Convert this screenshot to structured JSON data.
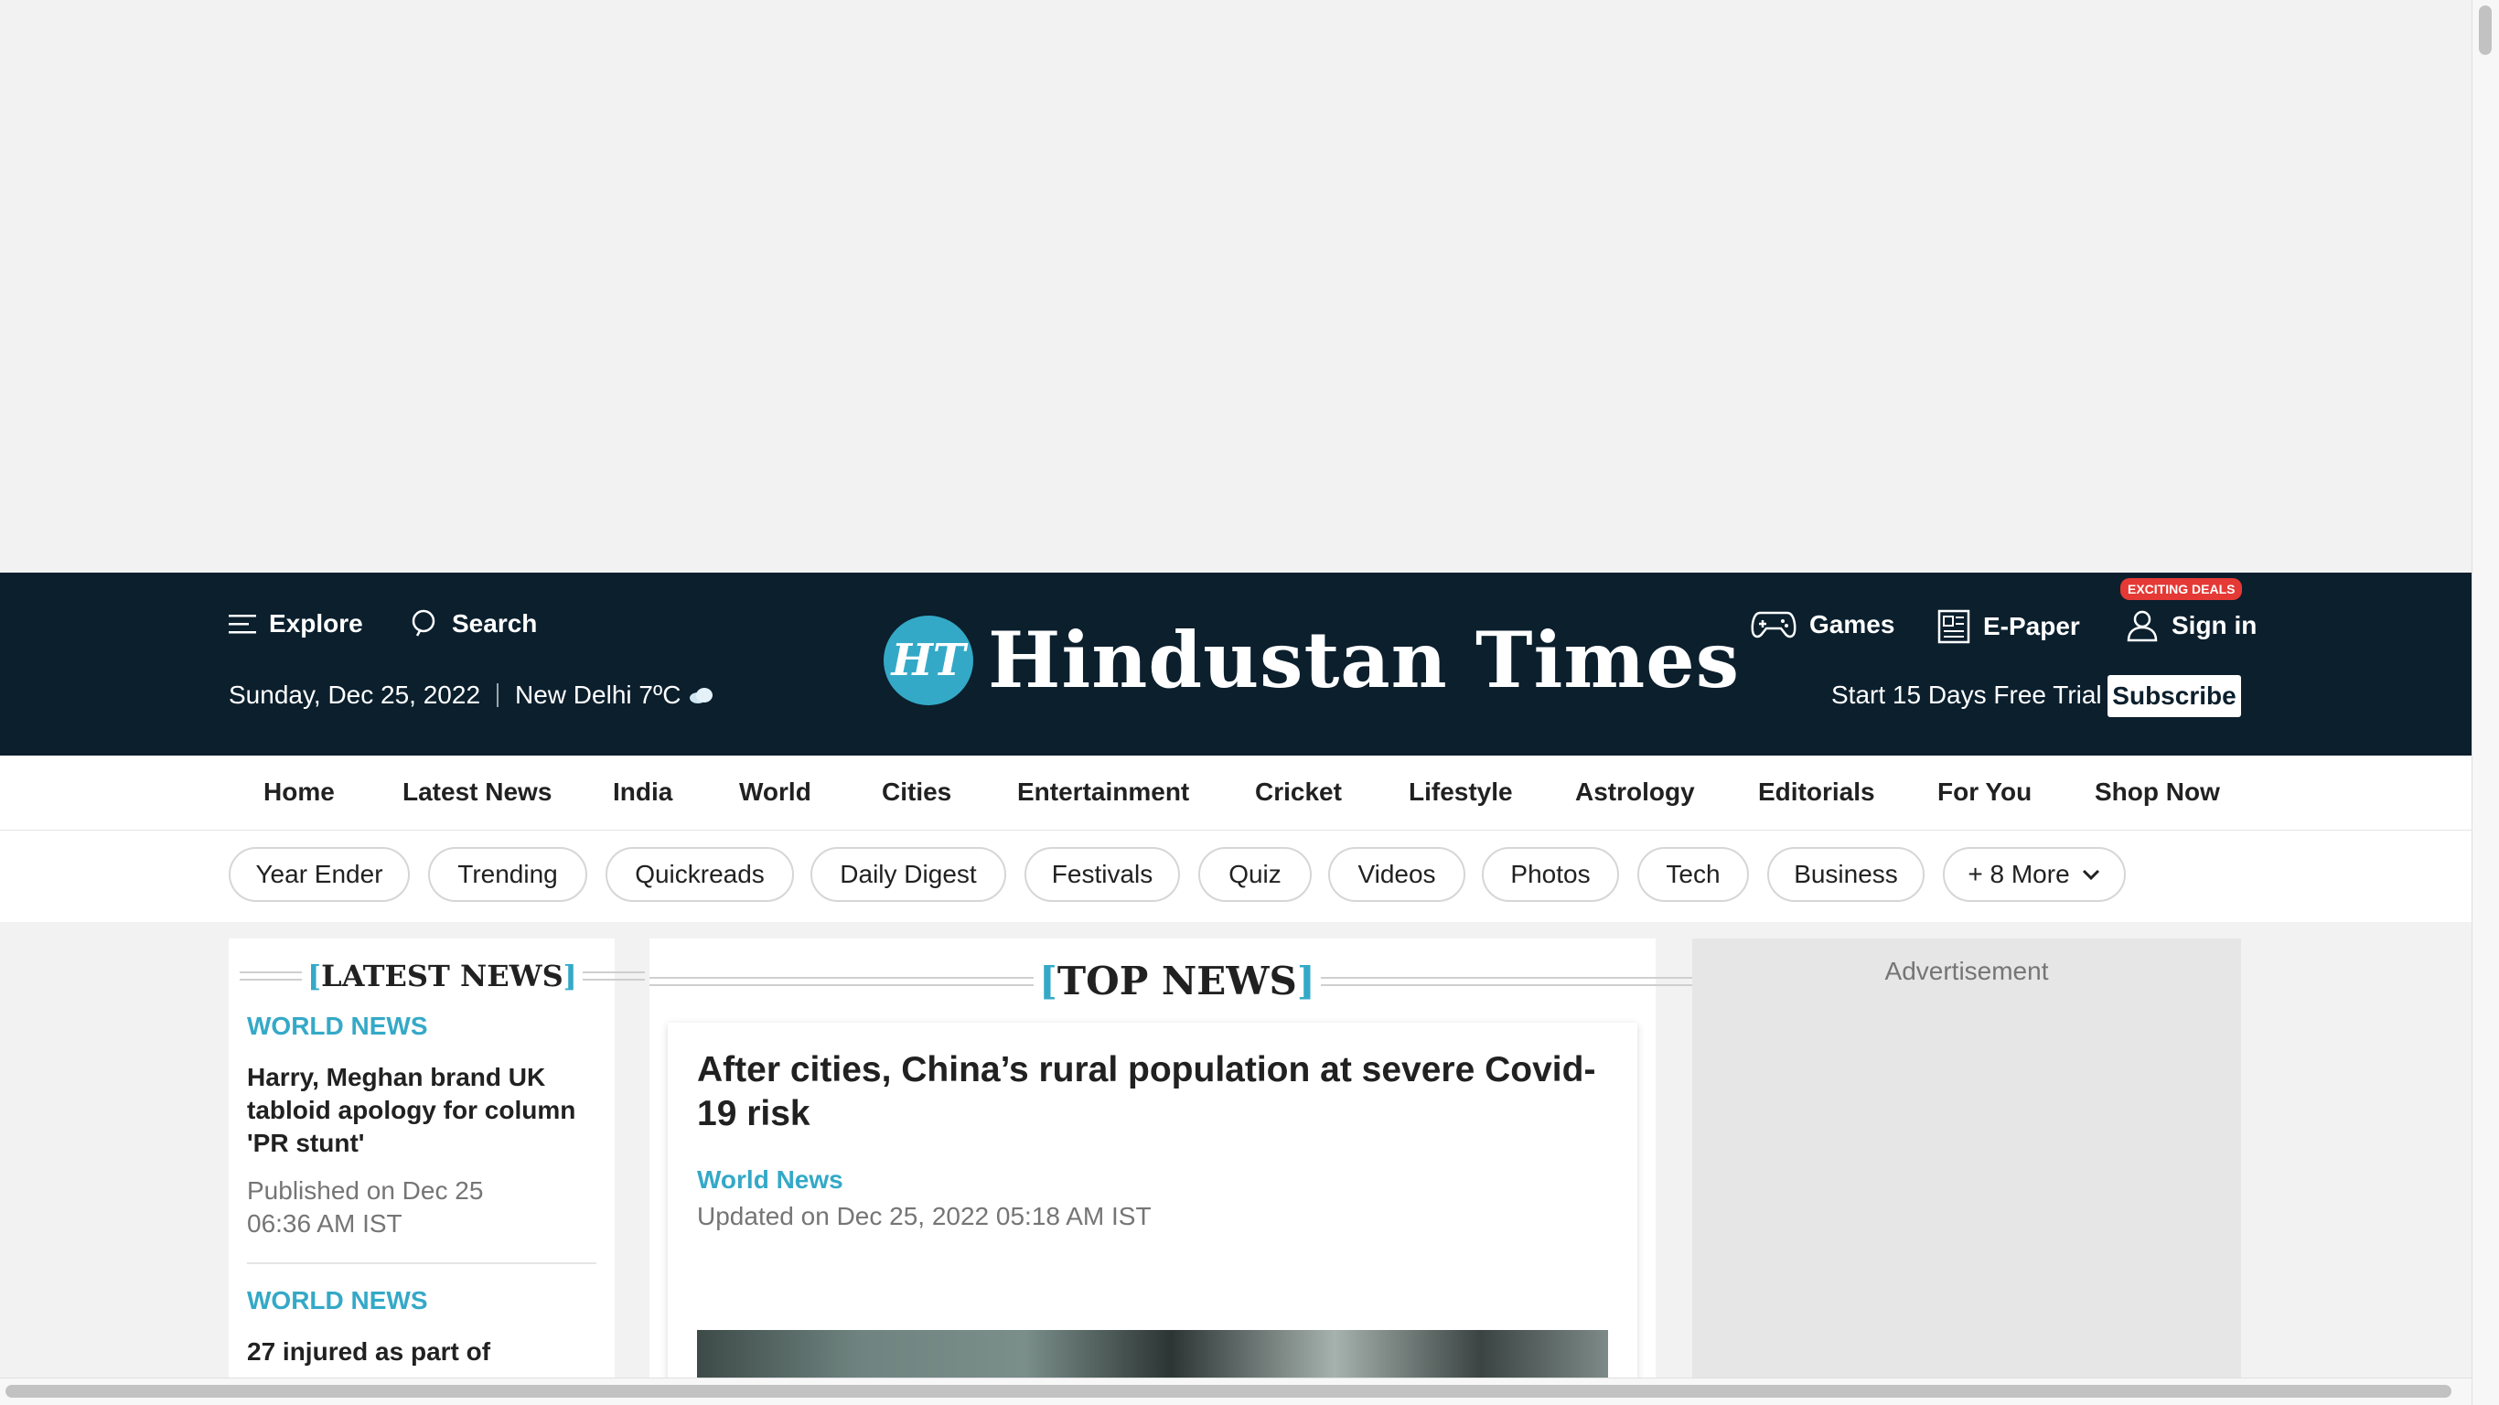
{
  "header": {
    "explore_label": "Explore",
    "search_label": "Search",
    "date": "Sunday, Dec 25, 2022",
    "city_weather": "New Delhi 7ºC",
    "logo_initials": "HT",
    "logo_text": "Hindustan Times",
    "games_label": "Games",
    "epaper_label": "E-Paper",
    "signin_label": "Sign in",
    "deals_badge": "EXCITING DEALS",
    "trial_text": "Start 15 Days Free Trial",
    "subscribe_label": "Subscribe"
  },
  "nav": {
    "items": [
      "Home",
      "Latest News",
      "India",
      "World",
      "Cities",
      "Entertainment",
      "Cricket",
      "Lifestyle",
      "Astrology",
      "Editorials",
      "For You",
      "Shop Now"
    ]
  },
  "pills": {
    "items": [
      "Year Ender",
      "Trending",
      "Quickreads",
      "Daily Digest",
      "Festivals",
      "Quiz",
      "Videos",
      "Photos",
      "Tech",
      "Business"
    ],
    "more_label": "+ 8 More"
  },
  "latest_news": {
    "title": "LATEST NEWS",
    "items": [
      {
        "category": "WORLD NEWS",
        "headline": "Harry, Meghan brand UK tabloid apology for column 'PR stunt'",
        "published": "Published on Dec 25 06:36 AM IST"
      },
      {
        "category": "WORLD NEWS",
        "headline": "27 injured as part of"
      }
    ]
  },
  "top_news": {
    "title": "TOP NEWS",
    "headline": "After cities, China’s rural population at severe Covid-19 risk",
    "category": "World News",
    "updated": "Updated on Dec 25, 2022 05:18 AM IST"
  },
  "sidebar_ad": {
    "label": "Advertisement"
  },
  "colors": {
    "masthead_bg": "#0b1f2d",
    "accent": "#34a9c7",
    "deals_badge": "#e53935"
  }
}
